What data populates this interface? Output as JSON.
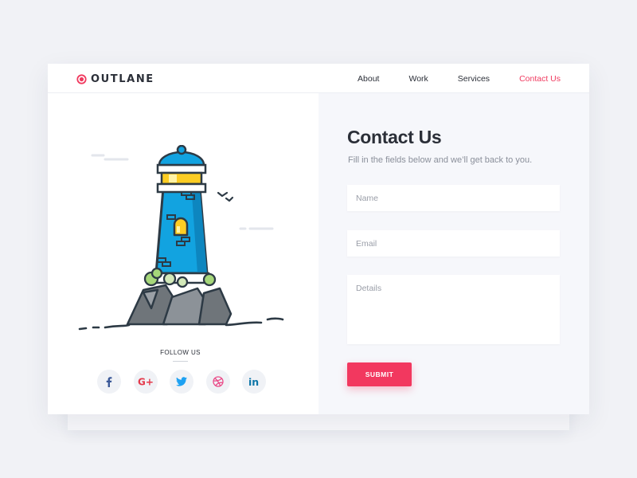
{
  "brand": {
    "name": "OUTLANE",
    "accent": "#f03a5f"
  },
  "nav": {
    "items": [
      {
        "label": "About"
      },
      {
        "label": "Work"
      },
      {
        "label": "Services"
      },
      {
        "label": "Contact Us",
        "active": true
      }
    ]
  },
  "illustration": {
    "subject": "lighthouse-icon"
  },
  "follow": {
    "label": "FOLLOW US",
    "networks": [
      {
        "icon": "facebook-icon",
        "color": "#3b5998"
      },
      {
        "icon": "google-plus-icon",
        "color": "#e4394b"
      },
      {
        "icon": "twitter-icon",
        "color": "#1da1f2"
      },
      {
        "icon": "dribbble-icon",
        "color": "#ea4c89"
      },
      {
        "icon": "linkedin-icon",
        "color": "#0e76a8"
      }
    ]
  },
  "form": {
    "title": "Contact Us",
    "subtitle": "Fill in the fields below and we’ll get back to you.",
    "name_placeholder": "Name",
    "email_placeholder": "Email",
    "details_placeholder": "Details",
    "submit_label": "SUBMIT"
  }
}
